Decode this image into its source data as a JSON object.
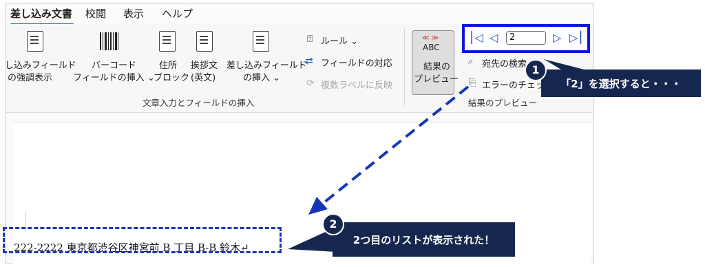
{
  "tabs": [
    {
      "label": "差し込み文書",
      "active": true
    },
    {
      "label": "校閲"
    },
    {
      "label": "表示"
    },
    {
      "label": "ヘルプ"
    }
  ],
  "ribbon": {
    "highlight": {
      "line1": "し込みフィールド",
      "line2": "の強調表示"
    },
    "barcode": {
      "line1": "バーコード",
      "line2": "フィールドの挿入 ⌄"
    },
    "address": {
      "line1": "住所",
      "line2": "ブロック"
    },
    "greeting": {
      "line1": "挨拶文",
      "line2": "(英文)"
    },
    "merge_field": {
      "line1": "差し込みフィールド",
      "line2": "の挿入 ⌄"
    },
    "rules": "ルール ⌄",
    "match_fields": "フィールドの対応",
    "update_labels": "複数ラベルに反映",
    "group_label": "文章入力とフィールドの挿入",
    "preview_results": {
      "icon_text": "ABC",
      "icon_arrows": "≪ ≫",
      "line1": "結果の",
      "line2": "プレビュー"
    },
    "find_recipient": "宛先の検索",
    "check_errors": "エラーのチェッ",
    "preview_group_label": "結果のプレビュー",
    "record_value": "2",
    "nav_first": "⎮◁",
    "nav_prev": "◁",
    "nav_next": "▷",
    "nav_last": "▷⎮"
  },
  "document": {
    "line": "222-2222 東京都渋谷区神宮前 B 丁目 B-B 鈴木↵"
  },
  "annotations": {
    "badge1": "1",
    "callout1": "「2」を選択すると・・・",
    "badge2": "2",
    "callout2": "2つ目のリストが表示された！"
  },
  "colors": {
    "annotation_blue": "#0b18d9",
    "callout_navy": "#16274f",
    "tab_underline": "#2c66b8"
  }
}
